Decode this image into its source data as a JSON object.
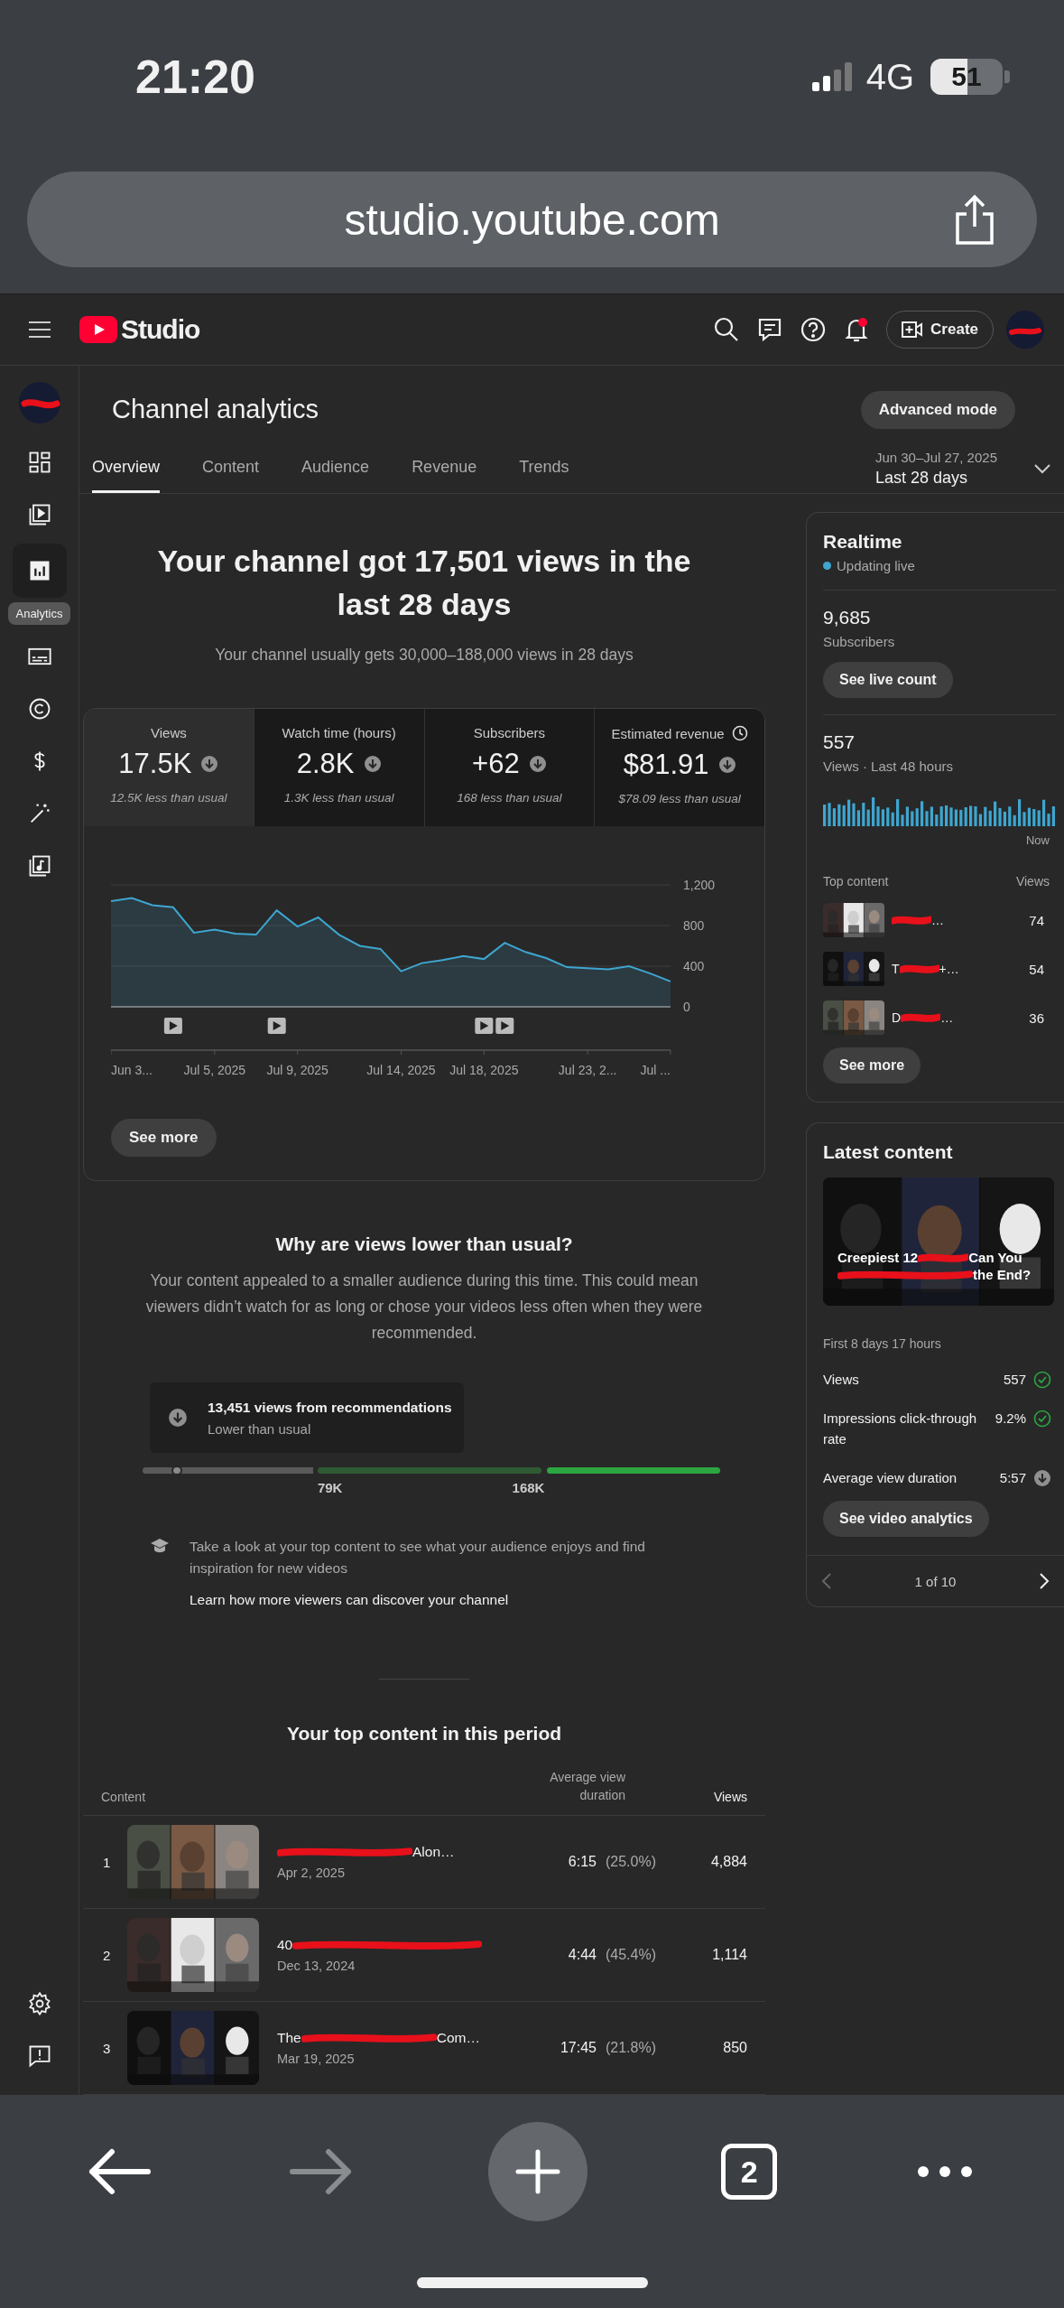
{
  "status_bar": {
    "time": "21:20",
    "network": "4G",
    "battery": {
      "text": "51",
      "level": 0.51
    }
  },
  "browser": {
    "url": "studio.youtube.com",
    "tab_count": "2",
    "forward_enabled": false
  },
  "app_header": {
    "logo": "Studio",
    "create_button": "Create",
    "notification": true
  },
  "nav_rail": {
    "items": [
      {
        "kind": "dashboard",
        "selected": false
      },
      {
        "kind": "content",
        "selected": false
      },
      {
        "kind": "analytics",
        "selected": true,
        "label": "Analytics"
      },
      {
        "kind": "subtitles",
        "selected": false
      },
      {
        "kind": "copyright",
        "selected": false
      },
      {
        "kind": "earn",
        "selected": false
      },
      {
        "kind": "customization",
        "selected": false
      },
      {
        "kind": "audio",
        "selected": false
      }
    ],
    "bottom": [
      {
        "kind": "settings"
      },
      {
        "kind": "feedback"
      }
    ]
  },
  "page": {
    "title": "Channel analytics",
    "advanced_button": "Advanced mode",
    "tabs": [
      {
        "label": "Overview",
        "selected": true
      },
      {
        "label": "Content",
        "selected": false
      },
      {
        "label": "Audience",
        "selected": false
      },
      {
        "label": "Revenue",
        "selected": false
      },
      {
        "label": "Trends",
        "selected": false
      }
    ],
    "date_range": {
      "dates": "Jun 30–Jul 27, 2025",
      "label": "Last 28 days"
    }
  },
  "summary": {
    "headline": "Your channel got 17,501 views in the last 28 days",
    "subtext": "Your channel usually gets 30,000–188,000 views in 28 days"
  },
  "metrics": [
    {
      "label": "Views",
      "value": "17.5K",
      "note": "12.5K less than usual",
      "selected": true,
      "clock_icon": false
    },
    {
      "label": "Watch time (hours)",
      "value": "2.8K",
      "note": "1.3K less than usual",
      "selected": false,
      "clock_icon": false
    },
    {
      "label": "Subscribers",
      "value": "+62",
      "note": "168 less than usual",
      "selected": false,
      "clock_icon": false
    },
    {
      "label": "Estimated revenue",
      "value": "$81.91",
      "note": "$78.09 less than usual",
      "selected": false,
      "clock_icon": true
    }
  ],
  "chart_data": {
    "type": "area",
    "ylim": [
      0,
      1200
    ],
    "yticks": [
      0,
      400,
      800,
      {
        "value": 1200,
        "label": "1,200"
      }
    ],
    "series": [
      {
        "color": "#3ea6d0",
        "values": [
          1040,
          1070,
          1000,
          980,
          730,
          760,
          720,
          710,
          950,
          790,
          880,
          710,
          600,
          570,
          350,
          430,
          460,
          500,
          470,
          630,
          540,
          480,
          390,
          380,
          370,
          400,
          330,
          250
        ]
      }
    ]
  },
  "chart_x_labels": [
    "Jun 3...",
    "Jul 5, 2025",
    "Jul 9, 2025",
    "Jul 14, 2025",
    "Jul 18, 2025",
    "Jul 23, 2...",
    "Jul ..."
  ],
  "video_markers": [
    {
      "kind": "video"
    },
    {
      "kind": "video"
    },
    {
      "kind": "video"
    },
    {
      "kind": "video"
    }
  ],
  "see_more": "See more",
  "insight": {
    "title": "Why are views lower than usual?",
    "body": "Your content appealed to a smaller audience during this time. This could mean viewers didn’t watch for as long or chose your videos less often when they were recommended.",
    "recommendation": {
      "text": "13,451 views from recommendations",
      "status": "Lower than usual"
    },
    "range": {
      "level": 0.06,
      "labels": [
        "79K",
        "168K"
      ]
    },
    "tip": "Take a look at your top content to see what your audience enjoys and find inspiration for new videos",
    "link": "Learn how more viewers can discover your channel"
  },
  "top_content": {
    "title": "Your top content in this period",
    "columns": [
      "Content",
      "Average view duration",
      "Views"
    ],
    "rows": [
      {
        "rank": "1",
        "title_end": "Alon…",
        "date": "Apr 2, 2025",
        "duration": "6:15",
        "percent": "(25.0%)",
        "views": "4,884"
      },
      {
        "rank": "2",
        "title_start": "40",
        "date": "Dec 13, 2024",
        "duration": "4:44",
        "percent": "(45.4%)",
        "views": "1,114"
      },
      {
        "rank": "3",
        "title_start": "The",
        "title_end": "Com…",
        "date": "Mar 19, 2025",
        "duration": "17:45",
        "percent": "(21.8%)",
        "views": "850"
      }
    ]
  },
  "realtime": {
    "title": "Realtime",
    "status": "Updating live",
    "subscribers": "9,685",
    "subscribers_label": "Subscribers",
    "live_button": "See live count",
    "views": "557",
    "views_label": "Views · Last 48 hours",
    "now_label": "Now",
    "columns": [
      "Top content",
      "Views"
    ],
    "top": [
      {
        "title_end": "…",
        "views": "74"
      },
      {
        "title_start": "T",
        "title_end": "+…",
        "views": "54"
      },
      {
        "title_start": "D",
        "title_end": "…",
        "views": "36"
      }
    ],
    "see_more": "See more"
  },
  "latest": {
    "title": "Latest content",
    "overlay_start": "Creepiest 12",
    "overlay_mid": "Can You",
    "overlay_end": "the End?",
    "period": "First 8 days 17 hours",
    "stats": [
      {
        "label": "Views",
        "value": "557",
        "kind": "check"
      },
      {
        "label": "Impressions click-through rate",
        "value": "9.2%",
        "kind": "check"
      },
      {
        "label": "Average view duration",
        "value": "5:57",
        "kind": "down"
      }
    ],
    "button": "See video analytics",
    "pager": "1 of 10"
  }
}
